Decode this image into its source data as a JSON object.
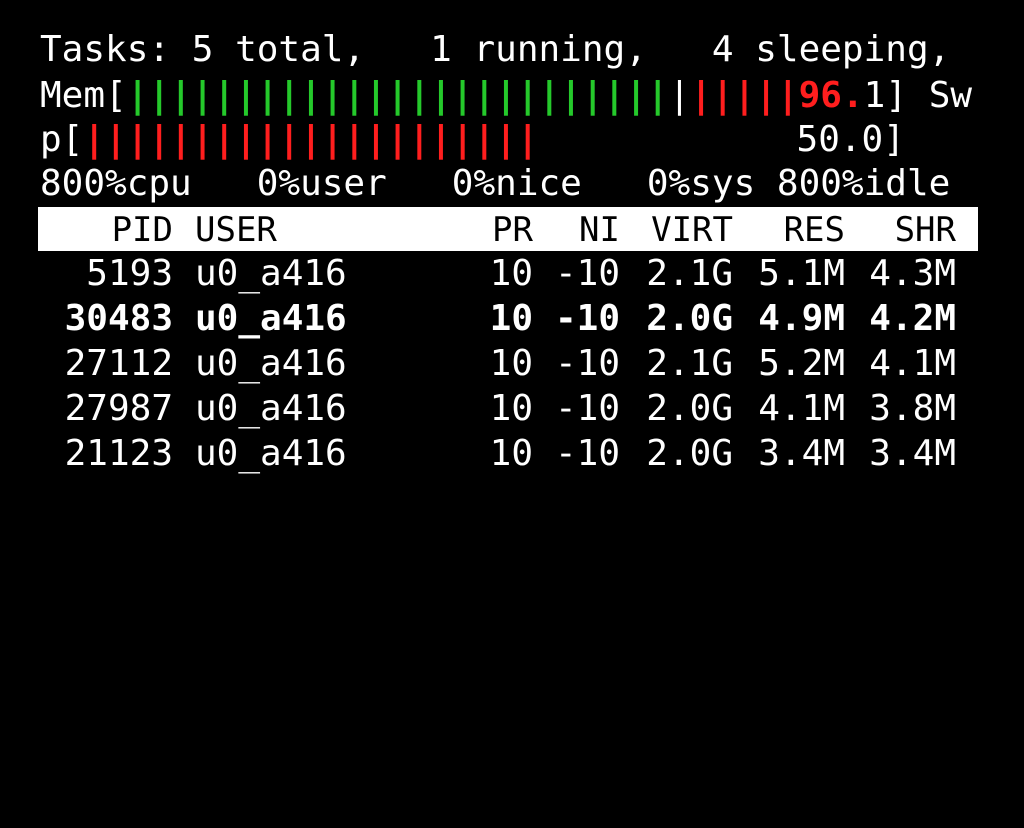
{
  "tasks_line": "Tasks: 5 total,   1 running,   4 sleeping,",
  "mem": {
    "label": "Mem[",
    "green_bars": "|||||||||||||||||||||||||",
    "white_bar": "|",
    "red_bars": "|||||",
    "value_red": "96.",
    "value_white": "1",
    "close": "] Sw"
  },
  "swap": {
    "label": "p[",
    "red_bars": "|||||||||||||||||||||",
    "value": "50.0]"
  },
  "cpu_line": "800%cpu   0%user   0%nice   0%sys 800%idle",
  "colors": {
    "green": "#25c92b",
    "red": "#ff1e1e",
    "header_bg": "#ffffff"
  },
  "table": {
    "headers": {
      "pid": "PID",
      "user": "USER",
      "pr": "PR",
      "ni": "NI",
      "virt": "VIRT",
      "res": "RES",
      "shr": "SHR"
    },
    "rows": [
      {
        "pid": "5193",
        "user": "u0_a416",
        "pr": "10",
        "ni": "-10",
        "virt": "2.1G",
        "res": "5.1M",
        "shr": "4.3M",
        "bold": false
      },
      {
        "pid": "30483",
        "user": "u0_a416",
        "pr": "10",
        "ni": "-10",
        "virt": "2.0G",
        "res": "4.9M",
        "shr": "4.2M",
        "bold": true
      },
      {
        "pid": "27112",
        "user": "u0_a416",
        "pr": "10",
        "ni": "-10",
        "virt": "2.1G",
        "res": "5.2M",
        "shr": "4.1M",
        "bold": false
      },
      {
        "pid": "27987",
        "user": "u0_a416",
        "pr": "10",
        "ni": "-10",
        "virt": "2.0G",
        "res": "4.1M",
        "shr": "3.8M",
        "bold": false
      },
      {
        "pid": "21123",
        "user": "u0_a416",
        "pr": "10",
        "ni": "-10",
        "virt": "2.0G",
        "res": "3.4M",
        "shr": "3.4M",
        "bold": false
      }
    ]
  }
}
